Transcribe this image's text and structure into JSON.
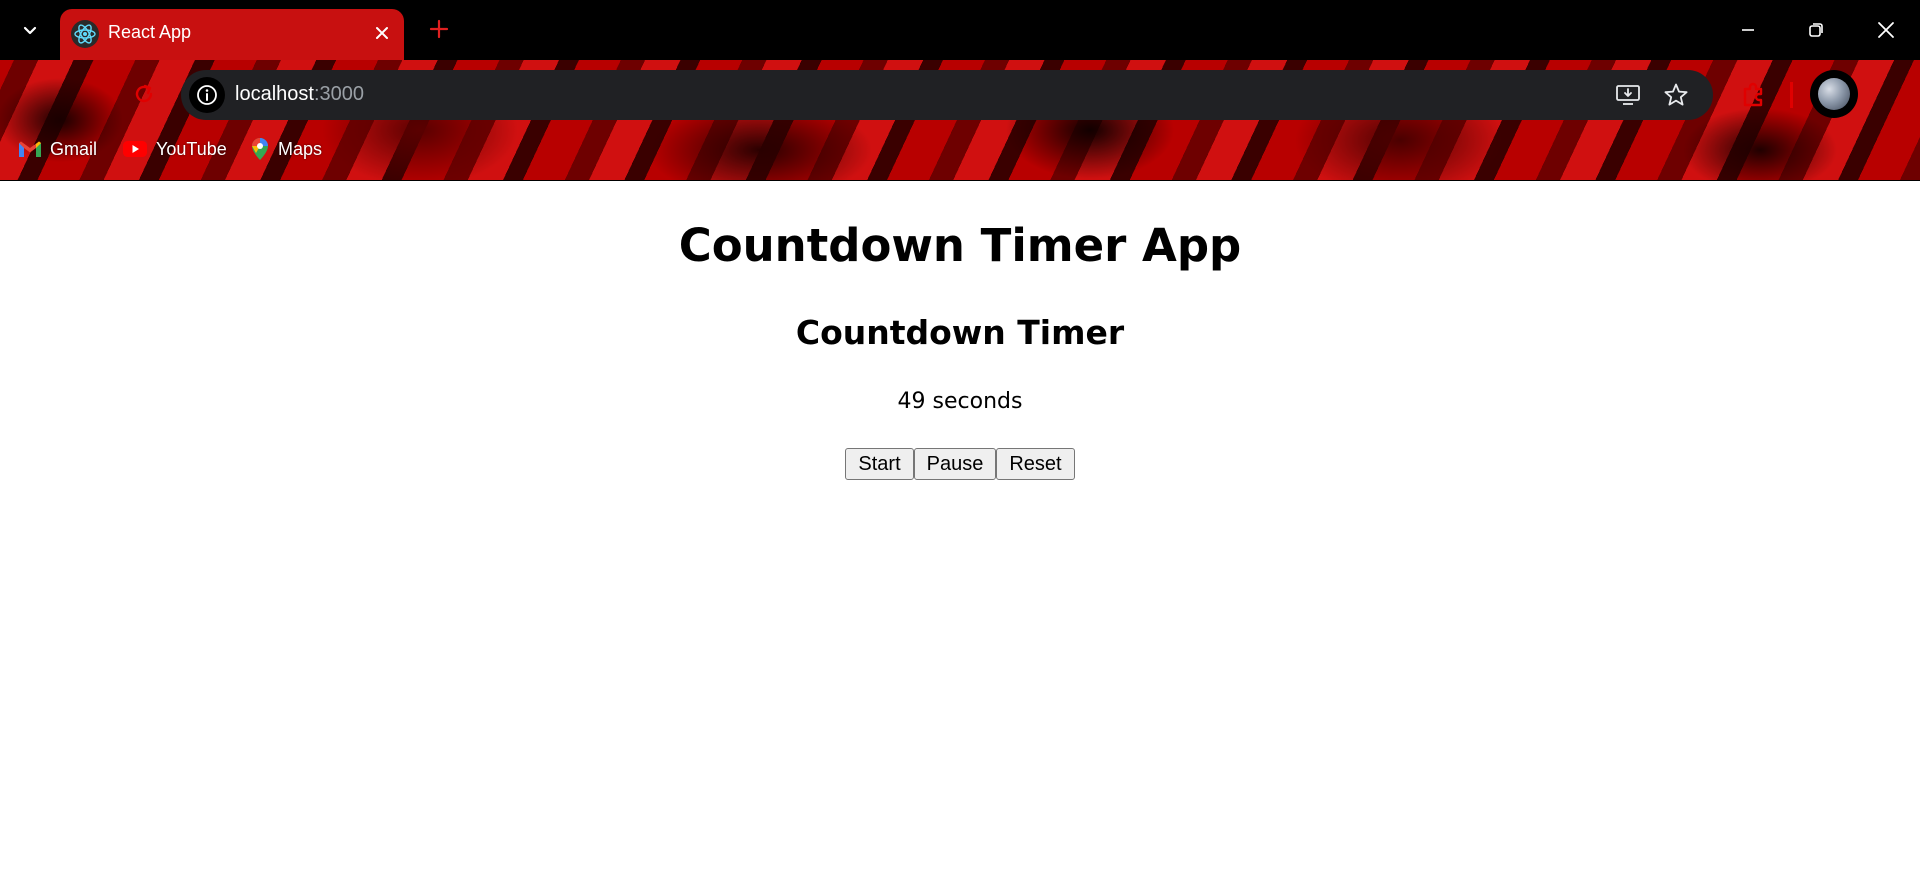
{
  "browser": {
    "tab": {
      "title": "React App",
      "favicon": "react-logo-icon"
    },
    "address": {
      "host": "localhost",
      "port": ":3000"
    },
    "bookmarks": [
      {
        "label": "Gmail",
        "icon": "gmail-icon"
      },
      {
        "label": "YouTube",
        "icon": "youtube-icon"
      },
      {
        "label": "Maps",
        "icon": "maps-icon"
      }
    ],
    "theme_colors": {
      "titlebar": "#000000",
      "tab": "#c81010",
      "omnibox": "#202124"
    }
  },
  "app": {
    "title": "Countdown Timer App",
    "timer": {
      "heading": "Countdown Timer",
      "display": "49 seconds",
      "buttons": {
        "start": "Start",
        "pause": "Pause",
        "reset": "Reset"
      }
    }
  }
}
